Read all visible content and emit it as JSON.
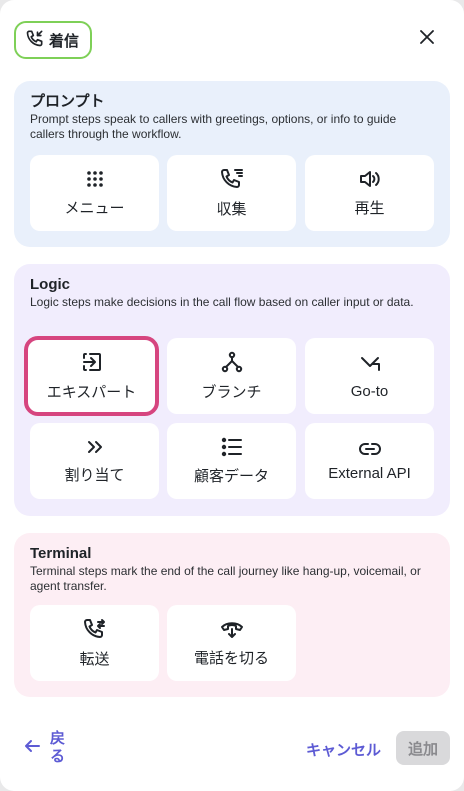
{
  "header": {
    "title": "着信",
    "icon": "phone-incoming-icon",
    "close_icon": "close-icon"
  },
  "sections": {
    "prompt": {
      "title": "プロンプト",
      "description": "Prompt steps speak to callers with greetings, options, or info to guide callers through the workflow.",
      "items": [
        {
          "label": "メニュー",
          "icon": "keypad-icon"
        },
        {
          "label": "収集",
          "icon": "phone-list-icon"
        },
        {
          "label": "再生",
          "icon": "speaker-icon"
        }
      ]
    },
    "logic": {
      "title": "Logic",
      "description": "Logic steps make decisions in the call flow based on caller input or data.",
      "items": [
        {
          "label": "エキスパート",
          "icon": "sign-in-icon"
        },
        {
          "label": "ブランチ",
          "icon": "branch-icon"
        },
        {
          "label": "Go-to",
          "icon": "arrow-jump-icon"
        },
        {
          "label": "割り当て",
          "icon": "double-chevron-right-icon"
        },
        {
          "label": "顧客データ",
          "icon": "list-icon"
        },
        {
          "label": "External API",
          "icon": "link-icon"
        }
      ]
    },
    "terminal": {
      "title": "Terminal",
      "description": "Terminal steps mark the end of the call journey like hang-up, voicemail, or agent transfer.",
      "items": [
        {
          "label": "転送",
          "icon": "phone-transfer-icon"
        },
        {
          "label": "電話を切る",
          "icon": "phone-hangup-icon"
        }
      ]
    }
  },
  "footer": {
    "back_label": "戻る",
    "cancel_label": "キャンセル",
    "add_label": "追加"
  },
  "colors": {
    "accent": "#5d5bd4",
    "highlight": "#d6457f",
    "chip_border": "#7ed057",
    "prompt_bg": "#e9f0fb",
    "logic_bg": "#f1edfd",
    "terminal_bg": "#fdeef4"
  }
}
